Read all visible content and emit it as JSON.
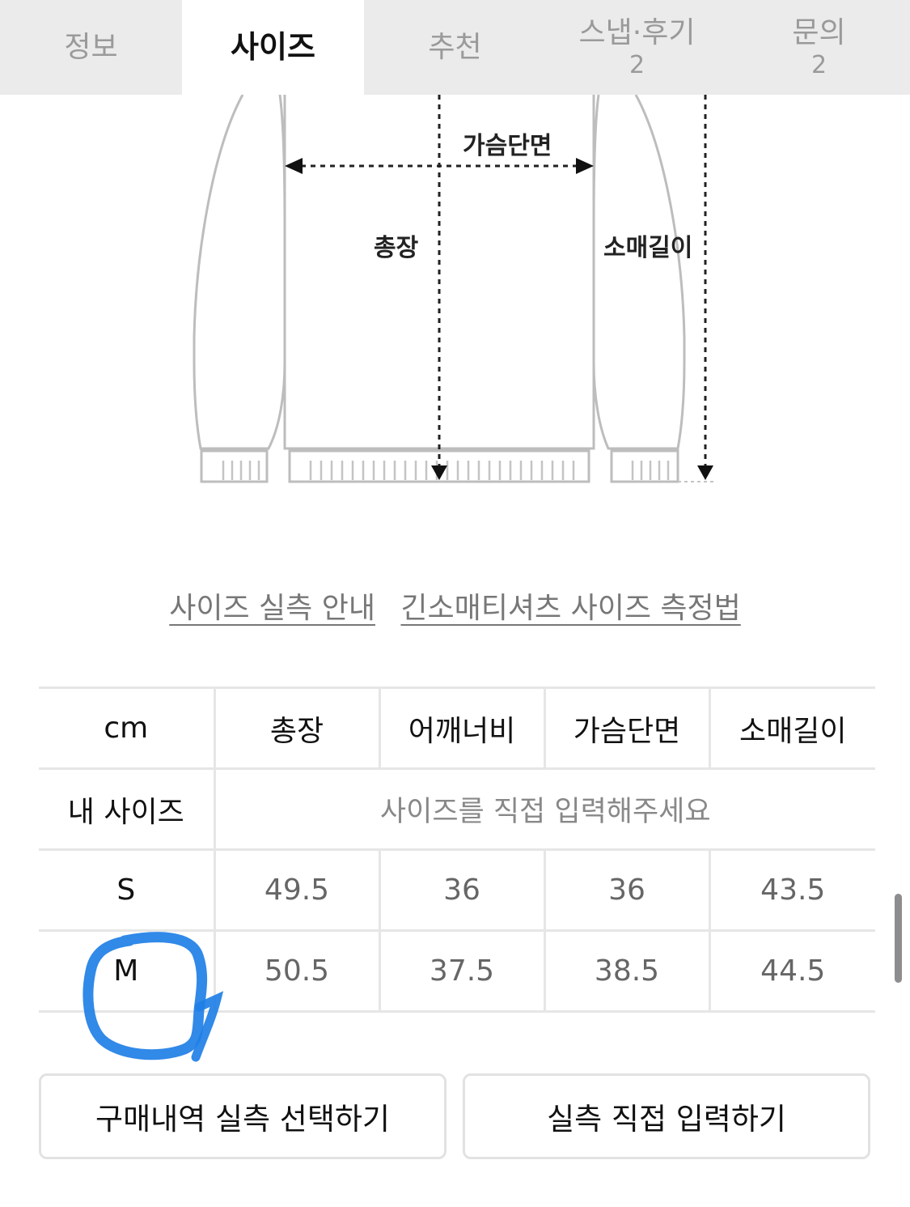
{
  "tabs": [
    {
      "label": "정보",
      "count": ""
    },
    {
      "label": "사이즈",
      "count": ""
    },
    {
      "label": "추천",
      "count": ""
    },
    {
      "label": "스냅·후기",
      "count": "2"
    },
    {
      "label": "문의",
      "count": "2"
    }
  ],
  "active_tab": "사이즈",
  "diagram": {
    "chest_label": "가슴단면",
    "length_label": "총장",
    "sleeve_label": "소매길이"
  },
  "links": {
    "size_guide": "사이즈 실측 안내",
    "measure_method": "긴소매티셔츠 사이즈 측정법"
  },
  "table": {
    "headers": [
      "cm",
      "총장",
      "어깨너비",
      "가슴단면",
      "소매길이"
    ],
    "my_size_label": "내 사이즈",
    "my_size_hint": "사이즈를 직접 입력해주세요",
    "rows": [
      {
        "size": "S",
        "values": [
          "49.5",
          "36",
          "36",
          "43.5"
        ]
      },
      {
        "size": "M",
        "values": [
          "50.5",
          "37.5",
          "38.5",
          "44.5"
        ]
      }
    ]
  },
  "buttons": {
    "purchase_history": "구매내역 실측 선택하기",
    "direct_input": "실측 직접 입력하기"
  },
  "colors": {
    "active_tab_bg": "#ffffff",
    "tab_bar_bg": "#ebebeb",
    "annotation": "#1f7fe6"
  }
}
